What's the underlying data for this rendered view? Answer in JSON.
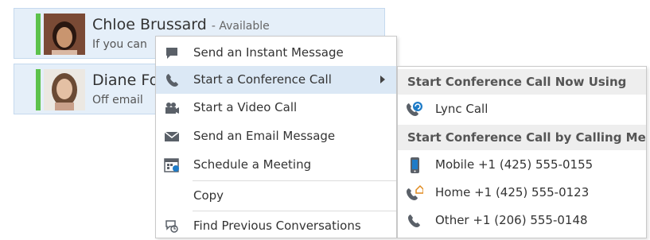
{
  "contacts": [
    {
      "name": "Chloe Brussard",
      "availability": "- Available",
      "status": "If you can"
    },
    {
      "name": "Diane Fo",
      "status": "Off email"
    }
  ],
  "menu": {
    "items": [
      {
        "label": "Send an Instant Message",
        "icon": "im-icon"
      },
      {
        "label": "Start a Conference Call",
        "icon": "phone-icon",
        "highlighted": true,
        "has_submenu": true
      },
      {
        "label": "Start a Video Call",
        "icon": "video-icon"
      },
      {
        "label": "Send an Email Message",
        "icon": "email-icon"
      },
      {
        "label": "Schedule a Meeting",
        "icon": "calendar-icon"
      },
      {
        "label": "Copy"
      },
      {
        "label": "Find Previous Conversations",
        "icon": "conversation-history-icon"
      }
    ]
  },
  "submenu": {
    "header1": "Start Conference Call Now Using",
    "lync": "Lync Call",
    "header2": "Start Conference Call by Calling Me",
    "mobile": "Mobile +1 (425) 555-0155",
    "home": "Home +1 (425) 555-0123",
    "other": "Other +1 (206) 555-0148"
  },
  "colors": {
    "presence": "#5cc24b",
    "highlight": "#dbe8f5",
    "card": "#e5eff9",
    "icon": "#5a6068",
    "accent": "#1e7bc7"
  }
}
